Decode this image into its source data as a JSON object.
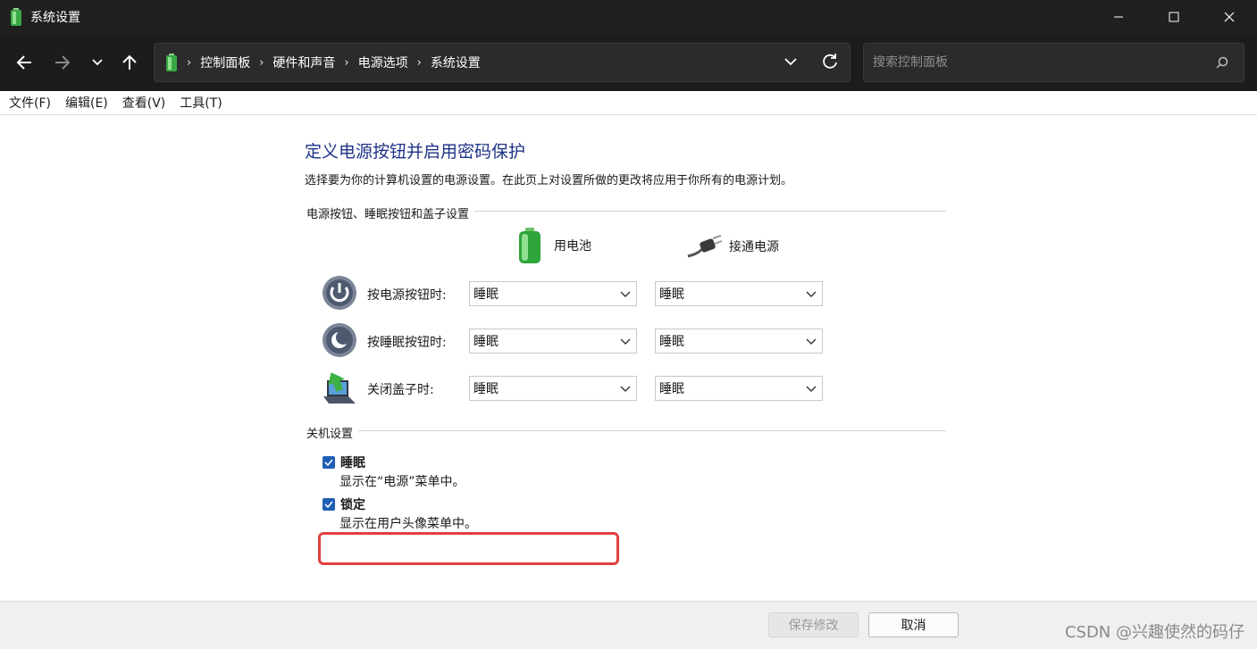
{
  "window": {
    "title": "系统设置",
    "controls": {
      "minimize": "minimize-icon",
      "maximize": "maximize-icon",
      "close": "close-icon"
    }
  },
  "nav": {
    "breadcrumbs": [
      "控制面板",
      "硬件和声音",
      "电源选项",
      "系统设置"
    ],
    "search_placeholder": "搜索控制面板"
  },
  "menu": [
    "文件(F)",
    "编辑(E)",
    "查看(V)",
    "工具(T)"
  ],
  "page": {
    "heading": "定义电源按钮并启用密码保护",
    "description": "选择要为你的计算机设置的电源设置。在此页上对设置所做的更改将应用于你所有的电源计划。",
    "buttons_section": {
      "title": "电源按钮、睡眠按钮和盖子设置",
      "columns": [
        "用电池",
        "接通电源"
      ],
      "rows": [
        {
          "label": "按电源按钮时:",
          "battery": "睡眠",
          "plugged": "睡眠",
          "icon": "power-button-icon"
        },
        {
          "label": "按睡眠按钮时:",
          "battery": "睡眠",
          "plugged": "睡眠",
          "icon": "sleep-button-icon"
        },
        {
          "label": "关闭盖子时:",
          "battery": "睡眠",
          "plugged": "睡眠",
          "icon": "laptop-lid-icon"
        }
      ]
    },
    "shutdown_section": {
      "title": "关机设置",
      "options": [
        {
          "label": "睡眠",
          "desc": "显示在“电源”菜单中。",
          "checked": true
        },
        {
          "label": "锁定",
          "desc": "显示在用户头像菜单中。",
          "checked": true
        }
      ]
    }
  },
  "footer": {
    "save_label": "保存修改",
    "cancel_label": "取消",
    "watermark": "CSDN @兴趣使然的码仔"
  },
  "colors": {
    "heading": "#1e3287",
    "checkbox": "#1f5fb4",
    "highlight": "#e0403f",
    "titlebar": "#202020"
  }
}
